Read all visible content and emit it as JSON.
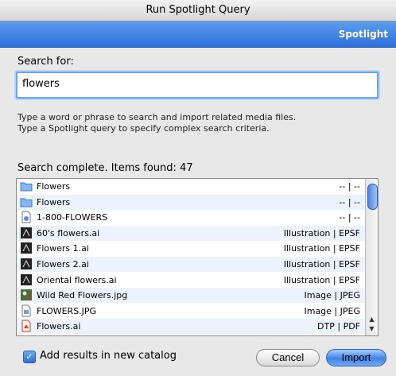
{
  "window": {
    "title": "Run Spotlight Query"
  },
  "banner": {
    "label": "Spotlight"
  },
  "search": {
    "label": "Search for:",
    "value": "flowers",
    "help_line1": "Type a word or phrase to search and import related media files.",
    "help_line2": "Type a Spotlight query to specify complex search criteria."
  },
  "status": {
    "text": "Search complete. Items found: 47"
  },
  "results": [
    {
      "icon": "folder-icon",
      "name": "Flowers",
      "kind": "-- | --"
    },
    {
      "icon": "folder-icon",
      "name": "Flowers",
      "kind": "-- | --"
    },
    {
      "icon": "web-location-icon",
      "name": "1-800-FLOWERS",
      "kind": "-- | --"
    },
    {
      "icon": "illustration-file-icon",
      "name": "60's flowers.ai",
      "kind": "Illustration | EPSF"
    },
    {
      "icon": "illustration-file-icon",
      "name": "Flowers 1.ai",
      "kind": "Illustration | EPSF"
    },
    {
      "icon": "illustration-file-icon",
      "name": "Flowers 2.ai",
      "kind": "Illustration | EPSF"
    },
    {
      "icon": "illustration-file-icon",
      "name": "Oriental flowers.ai",
      "kind": "Illustration | EPSF"
    },
    {
      "icon": "image-thumbnail-icon",
      "name": "Wild Red Flowers.jpg",
      "kind": "Image | JPEG"
    },
    {
      "icon": "jpeg-file-icon",
      "name": "FLOWERS.JPG",
      "kind": "Image | JPEG"
    },
    {
      "icon": "dtp-file-icon",
      "name": "Flowers.ai",
      "kind": "DTP | PDF"
    }
  ],
  "options": {
    "add_to_new_catalog_label": "Add results in new catalog",
    "add_to_new_catalog_checked": true
  },
  "buttons": {
    "cancel": "Cancel",
    "import": "Import"
  }
}
